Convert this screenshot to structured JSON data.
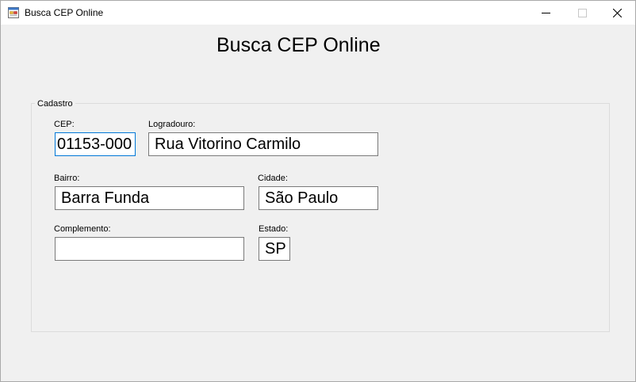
{
  "window": {
    "title": "Busca CEP Online"
  },
  "form": {
    "heading": "Busca CEP Online",
    "group_title": "Cadastro",
    "fields": {
      "cep": {
        "label": "CEP:",
        "value": "01153-000"
      },
      "logradouro": {
        "label": "Logradouro:",
        "value": "Rua Vitorino Carmilo"
      },
      "bairro": {
        "label": "Bairro:",
        "value": "Barra Funda"
      },
      "cidade": {
        "label": "Cidade:",
        "value": "São Paulo"
      },
      "complemento": {
        "label": "Complemento:",
        "value": ""
      },
      "estado": {
        "label": "Estado:",
        "value": "SP"
      }
    }
  },
  "icons": {
    "app": "app-form-icon",
    "minimize": "minimize-icon",
    "maximize": "maximize-icon",
    "close": "close-icon"
  },
  "colors": {
    "focus_border": "#0078d7",
    "window_bg": "#f0f0f0"
  }
}
